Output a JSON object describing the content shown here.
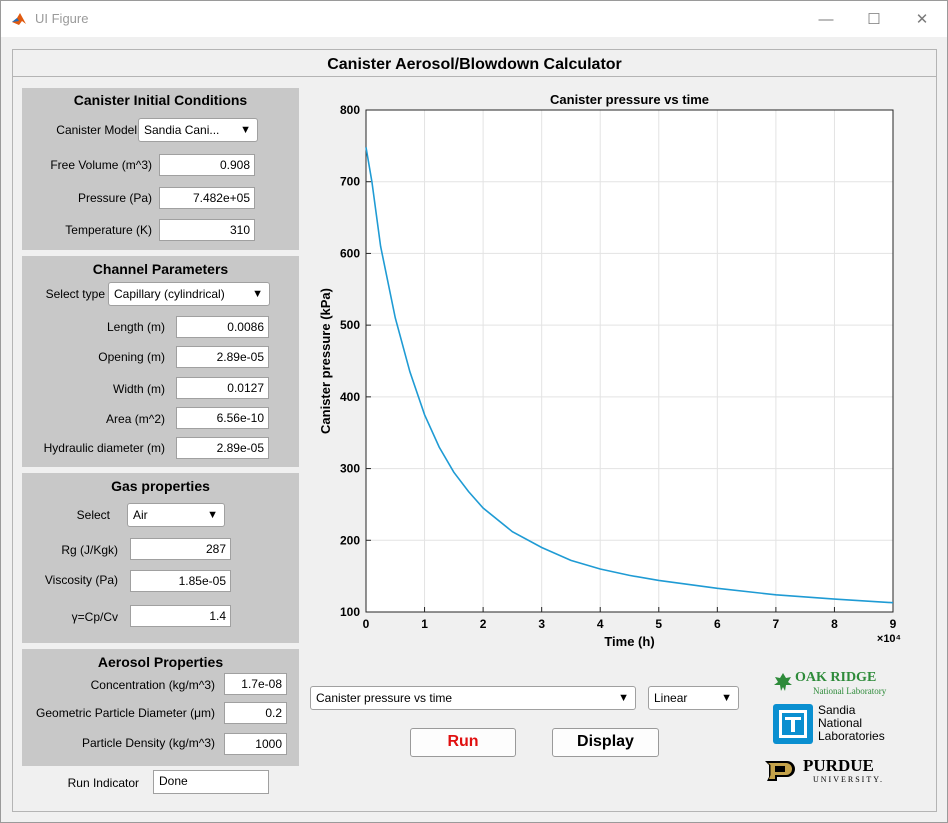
{
  "window": {
    "title": "UI Figure",
    "minimize": "—",
    "maximize": "☐",
    "close": "✕"
  },
  "app": {
    "title": "Canister Aerosol/Blowdown Calculator"
  },
  "canister": {
    "title": "Canister Initial Conditions",
    "model_label": "Canister Model",
    "model_value": "Sandia Cani...",
    "free_volume_label": "Free Volume (m^3)",
    "free_volume": "0.908",
    "pressure_label": "Pressure (Pa)",
    "pressure": "7.482e+05",
    "temperature_label": "Temperature (K)",
    "temperature": "310"
  },
  "channel": {
    "title": "Channel Parameters",
    "type_label": "Select type",
    "type_value": "Capillary (cylindrical)",
    "length_label": "Length (m)",
    "length": "0.0086",
    "opening_label": "Opening (m)",
    "opening": "2.89e-05",
    "width_label": "Width (m)",
    "width": "0.0127",
    "area_label": "Area (m^2)",
    "area": "6.56e-10",
    "hd_label": "Hydraulic diameter (m)",
    "hd": "2.89e-05"
  },
  "gas": {
    "title": "Gas properties",
    "select_label": "Select",
    "select_value": "Air",
    "rg_label": "Rg (J/Kgk)",
    "rg": "287",
    "viscosity_label": "Viscosity (Pa)",
    "viscosity": "1.85e-05",
    "gamma_label": "γ=Cp/Cv",
    "gamma": "1.4"
  },
  "aerosol": {
    "title": "Aerosol Properties",
    "conc_label": "Concentration (kg/m^3)",
    "conc": "1.7e-08",
    "diam_label": "Geometric Particle Diameter (μm)",
    "diam": "0.2",
    "density_label": "Particle Density (kg/m^3)",
    "density": "1000"
  },
  "run": {
    "indicator_label": "Run Indicator",
    "indicator_value": "Done"
  },
  "controls": {
    "plot_select": "Canister pressure vs time",
    "scale_select": "Linear",
    "run_label": "Run",
    "display_label": "Display",
    "run_color": "#e01010"
  },
  "logos": {
    "ornl_line1": "OAK RIDGE",
    "ornl_line2": "National Laboratory",
    "sandia_line1": "Sandia",
    "sandia_line2": "National",
    "sandia_line3": "Laboratories",
    "purdue_line1": "PURDUE",
    "purdue_line2": "UNIVERSITY."
  },
  "chart_data": {
    "type": "line",
    "title": "Canister pressure vs time",
    "xlabel": "Time (h)",
    "ylabel": "Canister pressure (kPa)",
    "x_exponent_label": "×10⁴",
    "xlim": [
      0,
      9
    ],
    "ylim": [
      100,
      800
    ],
    "xticks": [
      0,
      1,
      2,
      3,
      4,
      5,
      6,
      7,
      8,
      9
    ],
    "yticks": [
      100,
      200,
      300,
      400,
      500,
      600,
      700,
      800
    ],
    "grid": true,
    "line_color": "#1f9bd4",
    "series": [
      {
        "x": [
          0,
          0.1,
          0.25,
          0.5,
          0.75,
          1,
          1.25,
          1.5,
          1.75,
          2,
          2.5,
          3,
          3.5,
          4,
          4.5,
          5,
          6,
          7,
          8,
          9
        ],
        "values": [
          748,
          700,
          610,
          510,
          435,
          375,
          330,
          295,
          268,
          245,
          212,
          190,
          172,
          160,
          151,
          144,
          133,
          124,
          118,
          113
        ]
      }
    ]
  }
}
